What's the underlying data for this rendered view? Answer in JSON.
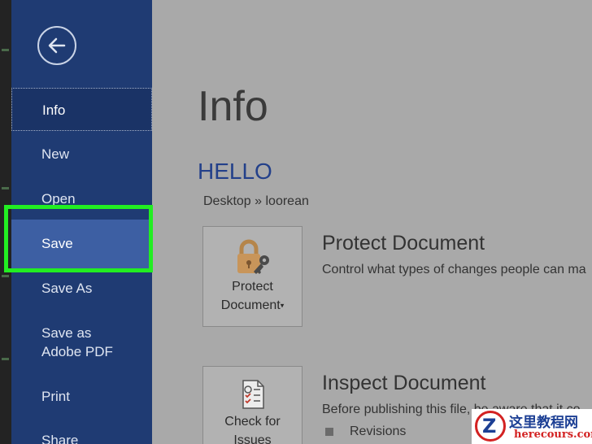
{
  "sidebar": {
    "back_icon": "arrow-left-icon",
    "items": [
      {
        "label": "Info"
      },
      {
        "label": "New"
      },
      {
        "label": "Open"
      },
      {
        "label": "Save"
      },
      {
        "label": "Save As"
      },
      {
        "label": "Save as Adobe PDF"
      },
      {
        "label": "Print"
      },
      {
        "label": "Share"
      }
    ],
    "selected": "Info",
    "highlighted": "Save",
    "highlight_color": "#22ee22"
  },
  "main": {
    "title": "Info",
    "doc_name": "HELLO",
    "path": "Desktop » loorean",
    "sections": [
      {
        "tile_label_1": "Protect",
        "tile_label_2": "Document",
        "tile_icon": "lock-key-icon",
        "title": "Protect Document",
        "description": "Control what types of changes people can ma"
      },
      {
        "tile_label_1": "Check for",
        "tile_label_2": "Issues",
        "tile_icon": "inspect-document-icon",
        "title": "Inspect Document",
        "description": "Before publishing this file, be aware that it co",
        "bullets": [
          "Revisions"
        ]
      }
    ]
  },
  "watermark": {
    "logo_letter": "Z",
    "text_cn": "这里教程网",
    "text_en": "herecours.com"
  },
  "colors": {
    "sidebar_bg": "#1f3b73",
    "selected_bg": "#3d5fa3",
    "accent_blue": "#23408a",
    "content_bg": "#a9a9a9"
  }
}
